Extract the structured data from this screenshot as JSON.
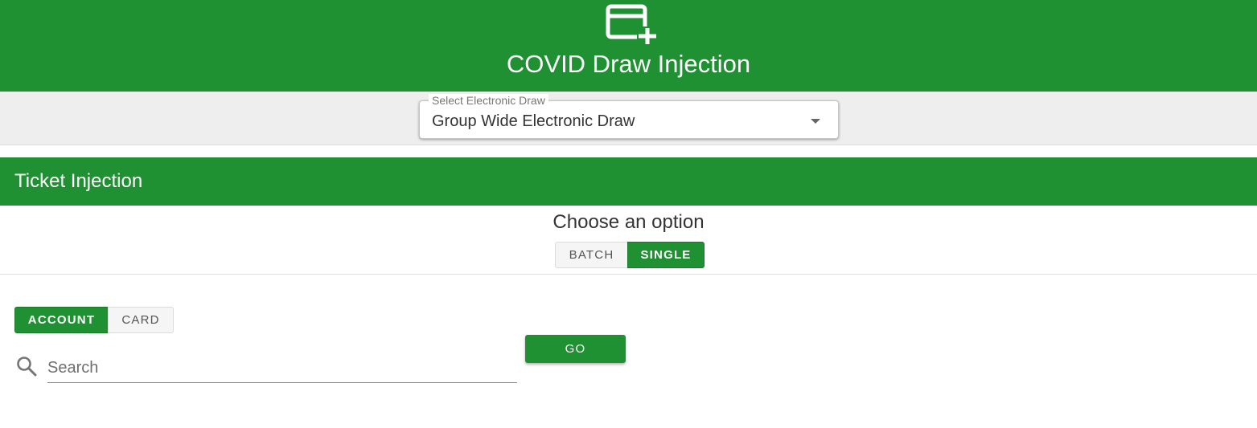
{
  "header": {
    "title": "COVID Draw Injection",
    "icon": "card-plus-icon"
  },
  "draw_select": {
    "label": "Select Electronic Draw",
    "value": "Group Wide Electronic Draw"
  },
  "section": {
    "title": "Ticket Injection"
  },
  "mode": {
    "heading": "Choose an option",
    "options": [
      "BATCH",
      "SINGLE"
    ],
    "selected": "SINGLE"
  },
  "lookup": {
    "options": [
      "ACCOUNT",
      "CARD"
    ],
    "selected": "ACCOUNT"
  },
  "search": {
    "placeholder": "Search"
  },
  "go_label": "GO",
  "colors": {
    "brand_green": "#209133",
    "toolbar_gray": "#eeeeee"
  }
}
